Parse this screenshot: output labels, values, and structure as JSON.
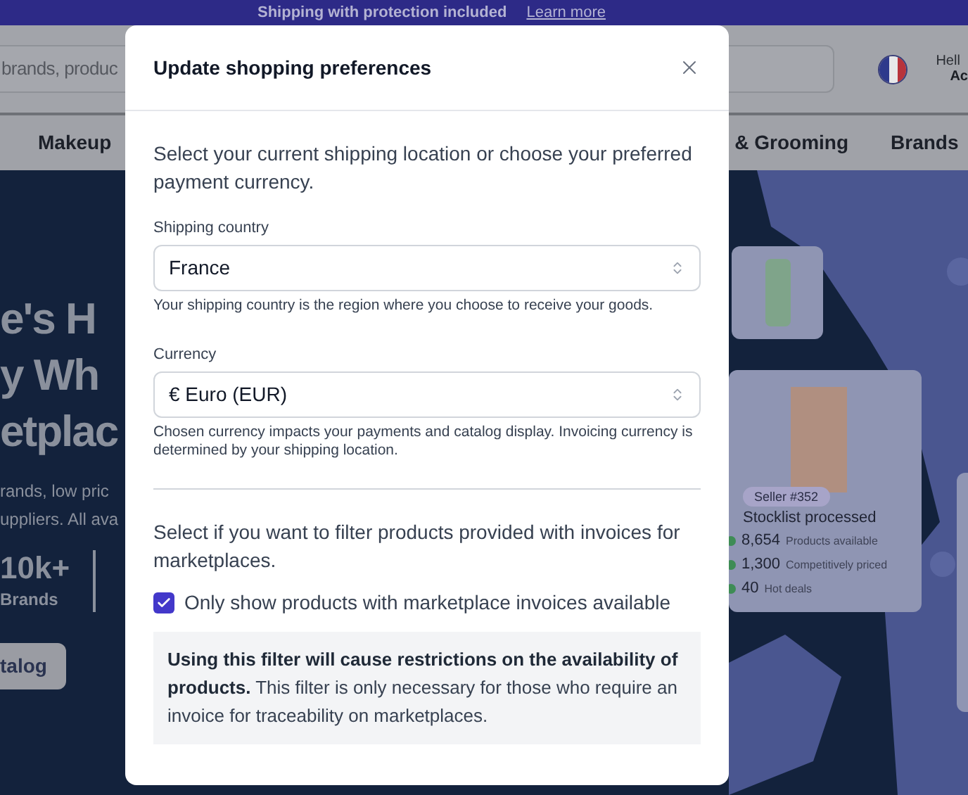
{
  "promo_banner": {
    "text": "Shipping with protection included",
    "link": "Learn more"
  },
  "header": {
    "search_placeholder": "brands, produc",
    "greeting": "Hell",
    "account": "Ac"
  },
  "nav": [
    "Makeup",
    "& Grooming",
    "Brands"
  ],
  "hero": {
    "heading_lines": [
      "e's H",
      "y Wh",
      "etplac"
    ],
    "subtitle_lines": [
      "rands, low pric",
      "uppliers. All ava"
    ],
    "stat": {
      "value": "10k+",
      "label": "Brands"
    },
    "button": "talog"
  },
  "map_card": {
    "badge": "Seller #352",
    "title": "Stocklist processed",
    "stats": [
      {
        "value": "8,654",
        "label": "Products available"
      },
      {
        "value": "1,300",
        "label": "Competitively priced"
      },
      {
        "value": "40",
        "label": "Hot deals"
      }
    ]
  },
  "dialog": {
    "title": "Update shopping preferences",
    "intro": "Select your current shipping location or choose your preferred payment currency.",
    "fields": [
      {
        "label": "Shipping country",
        "value": "France",
        "help": "Your shipping country is the region where you choose to receive your goods."
      },
      {
        "label": "Currency",
        "value": "€ Euro (EUR)",
        "help": "Chosen currency impacts your payments and catalog display. Invoicing currency is determined by your shipping location."
      }
    ],
    "filter_intro": "Select if you want to filter products provided with invoices for marketplaces.",
    "invoice_filter": {
      "label": "Only show products with marketplace invoices available",
      "checked": true
    },
    "note": "**Using this filter will cause restrictions on the availability of products.** This filter is only necessary for those who require an invoice for traceability on marketplaces."
  }
}
